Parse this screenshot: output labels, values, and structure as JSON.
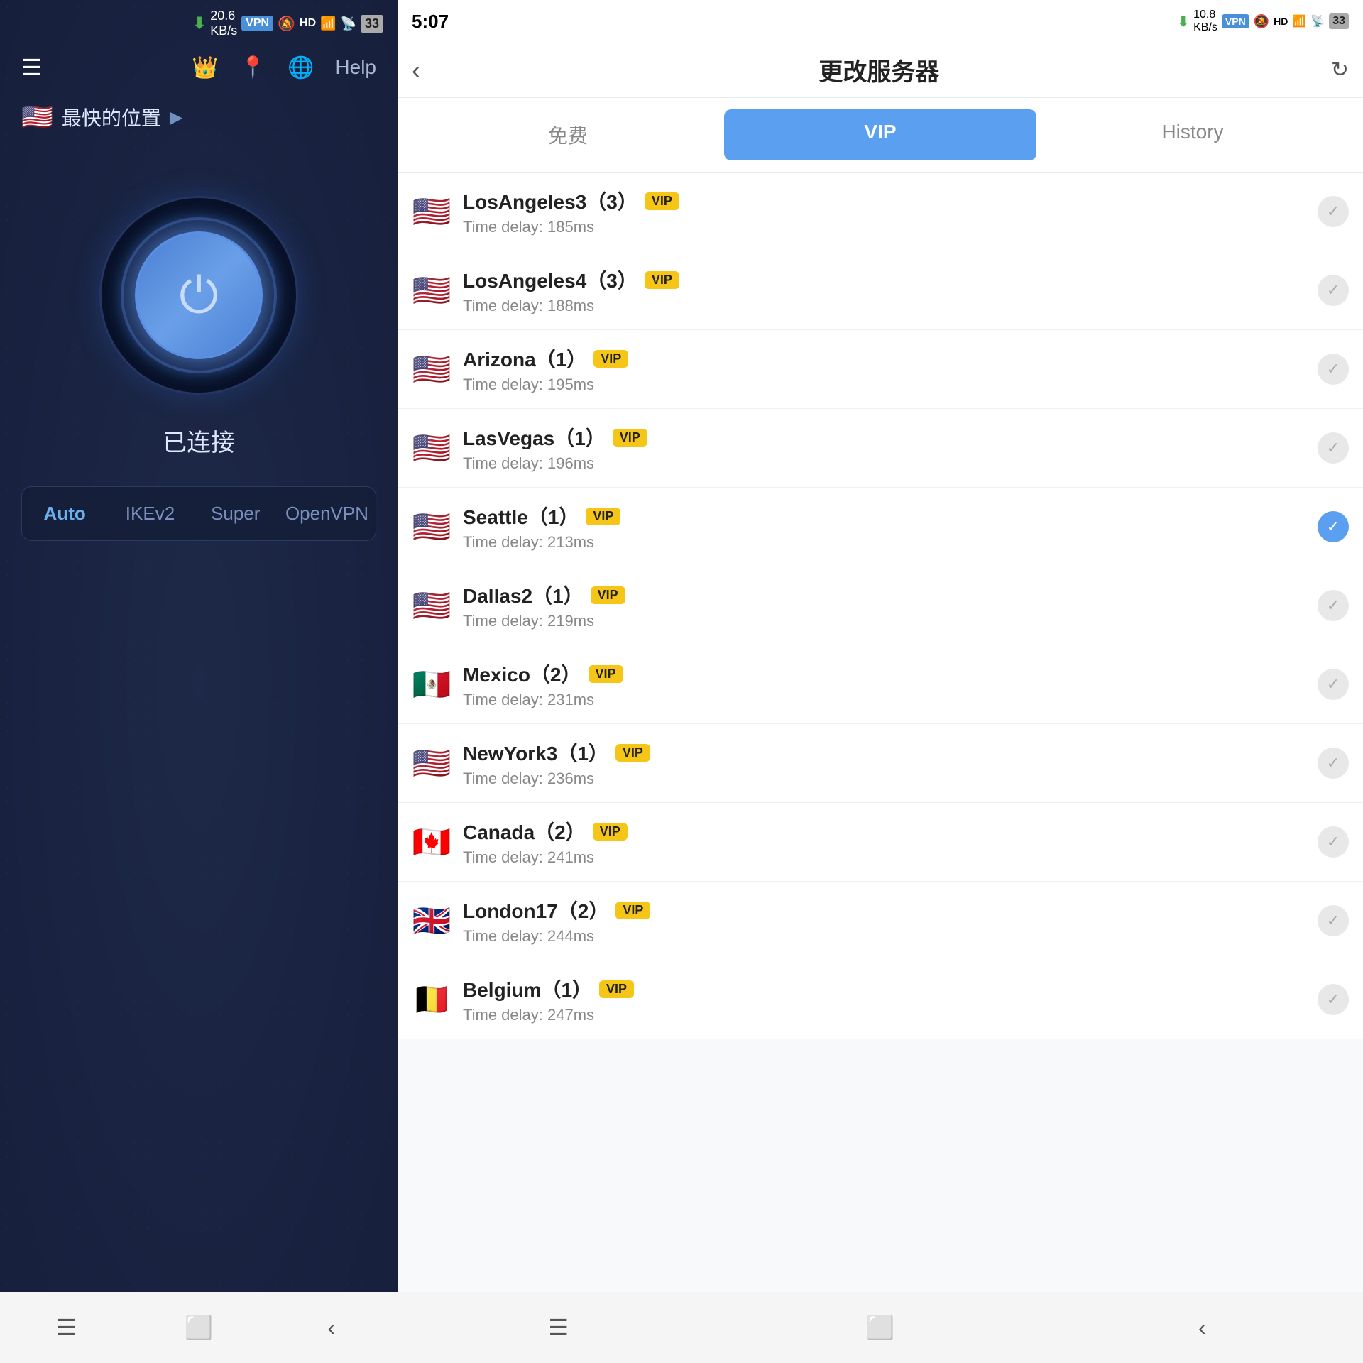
{
  "app": {
    "title": "更改服务器",
    "left_time": "5:07",
    "right_time": "5:07"
  },
  "left": {
    "location_text": "最快的位置",
    "connected_text": "已连接",
    "protocols": [
      "Auto",
      "IKEv2",
      "Super",
      "OpenVPN"
    ],
    "active_protocol": "Auto"
  },
  "tabs": [
    {
      "id": "free",
      "label": "免费"
    },
    {
      "id": "vip",
      "label": "VIP"
    },
    {
      "id": "history",
      "label": "History"
    }
  ],
  "active_tab": "vip",
  "servers": [
    {
      "id": 1,
      "name": "LosAngeles3（3）",
      "flag": "us",
      "delay": "Time delay: 185ms",
      "vip": true,
      "selected": false
    },
    {
      "id": 2,
      "name": "LosAngeles4（3）",
      "flag": "us",
      "delay": "Time delay: 188ms",
      "vip": true,
      "selected": false
    },
    {
      "id": 3,
      "name": "Arizona（1）",
      "flag": "us",
      "delay": "Time delay: 195ms",
      "vip": true,
      "selected": false
    },
    {
      "id": 4,
      "name": "LasVegas（1）",
      "flag": "us",
      "delay": "Time delay: 196ms",
      "vip": true,
      "selected": false
    },
    {
      "id": 5,
      "name": "Seattle（1）",
      "flag": "us",
      "delay": "Time delay: 213ms",
      "vip": true,
      "selected": true
    },
    {
      "id": 6,
      "name": "Dallas2（1）",
      "flag": "us",
      "delay": "Time delay: 219ms",
      "vip": true,
      "selected": false
    },
    {
      "id": 7,
      "name": "Mexico（2）",
      "flag": "mx",
      "delay": "Time delay: 231ms",
      "vip": true,
      "selected": false
    },
    {
      "id": 8,
      "name": "NewYork3（1）",
      "flag": "us",
      "delay": "Time delay: 236ms",
      "vip": true,
      "selected": false
    },
    {
      "id": 9,
      "name": "Canada（2）",
      "flag": "ca",
      "delay": "Time delay: 241ms",
      "vip": true,
      "selected": false
    },
    {
      "id": 10,
      "name": "London17（2）",
      "flag": "gb",
      "delay": "Time delay: 244ms",
      "vip": true,
      "selected": false
    },
    {
      "id": 11,
      "name": "Belgium（1）",
      "flag": "be",
      "delay": "Time delay: 247ms",
      "vip": true,
      "selected": false
    }
  ],
  "vip_label": "VIP",
  "colors": {
    "active_tab_bg": "#5ba0f0",
    "selected_check": "#5ba0f0",
    "vip_badge": "#f5c518"
  }
}
